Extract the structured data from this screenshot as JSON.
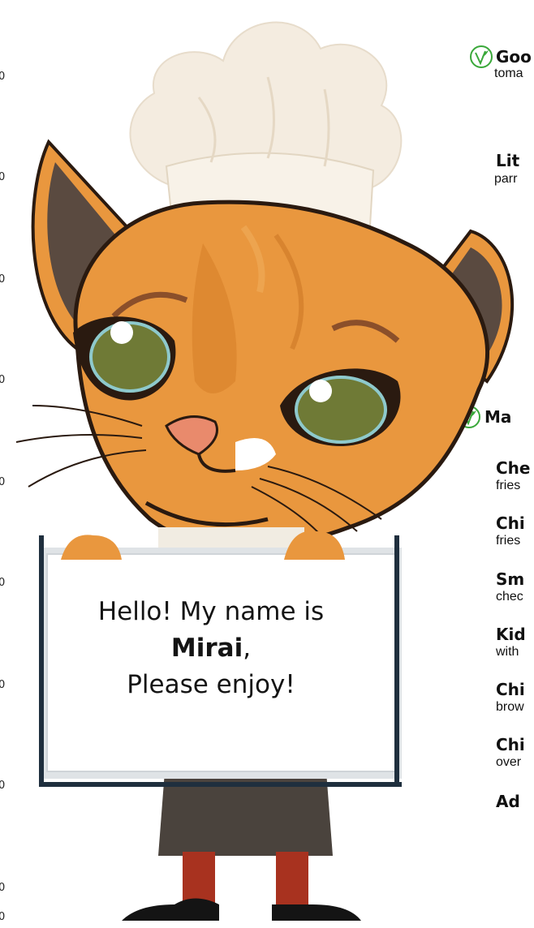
{
  "edge_numbers": [
    "0",
    "0",
    "0",
    "0",
    "0",
    "0",
    "0",
    "0",
    "0",
    "0"
  ],
  "sections": [
    {
      "heading": "Goo",
      "heading_desc": "toma"
    },
    {
      "heading": "Lit",
      "heading_desc": "parr"
    },
    {
      "heading": "Ma",
      "heading_desc": ""
    }
  ],
  "items": [
    {
      "name": "Che",
      "desc": "fries"
    },
    {
      "name": "Chi",
      "desc": "fries"
    },
    {
      "name": "Sm",
      "desc": "chec"
    },
    {
      "name": "Kid",
      "desc": "with"
    },
    {
      "name": "Chi",
      "desc": "brow"
    },
    {
      "name": "Chi",
      "desc": "over"
    },
    {
      "name": "Ad",
      "desc": ""
    }
  ],
  "sign": {
    "line1": "Hello! My name is",
    "name": "Mirai",
    "comma": ",",
    "line3": "Please enjoy!"
  },
  "colors": {
    "veg_green": "#3aa83a",
    "fur": "#e9973e",
    "sign_border": "#1f2f3e"
  },
  "icons": {
    "vegetarian": "leaf-v-icon"
  }
}
